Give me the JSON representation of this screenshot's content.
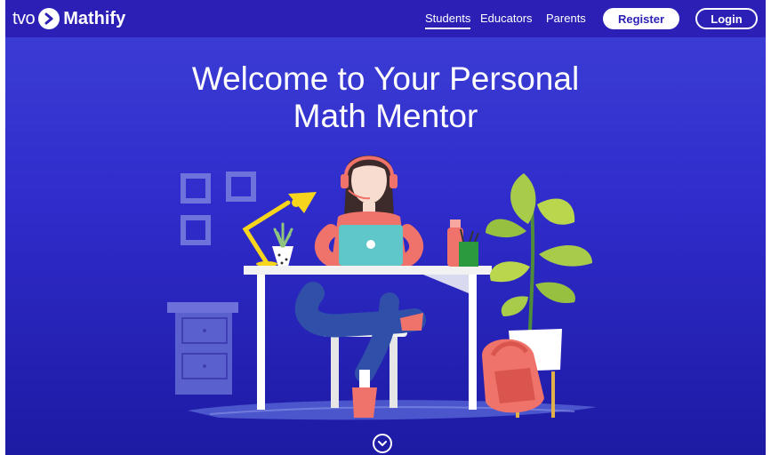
{
  "header": {
    "logo_prefix": "tvo",
    "logo_name": "Mathify",
    "nav": [
      "Students",
      "Educators",
      "Parents"
    ],
    "active_nav": "Students",
    "register_label": "Register",
    "login_label": "Login"
  },
  "hero": {
    "line1": "Welcome to Your Personal",
    "line2": "Math Mentor"
  },
  "colors": {
    "topbar": "#2b1fb5",
    "background_top": "#3d3fd6",
    "background_bottom": "#1d1aa3",
    "accent_red": "#f0736b",
    "accent_yellow": "#f7d51c"
  },
  "icons": {
    "logo": "chevron-right-in-circle-icon",
    "scroll": "chevron-down-circle-icon"
  }
}
